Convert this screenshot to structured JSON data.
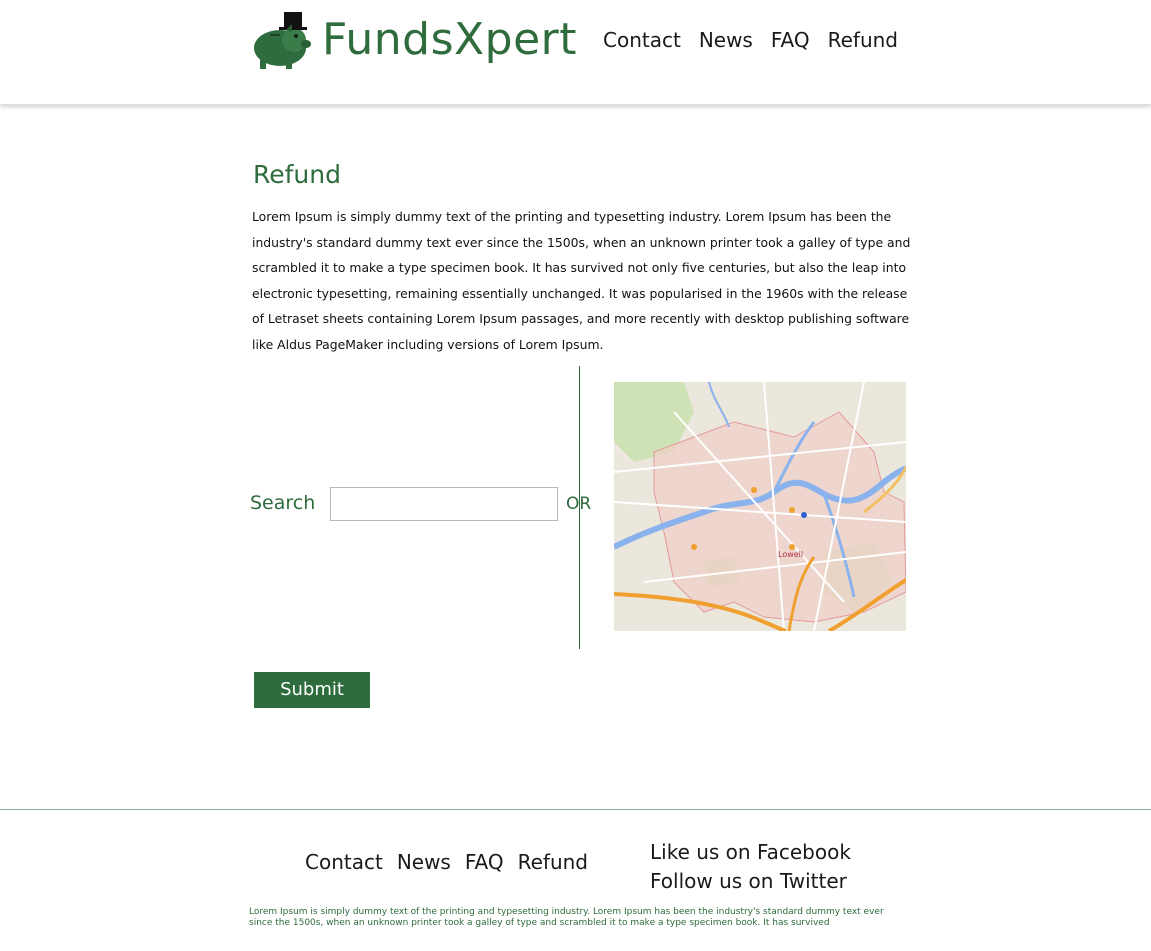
{
  "header": {
    "brand": "FundsXpert",
    "nav": [
      "Contact",
      "News",
      "FAQ",
      "Refund"
    ]
  },
  "main": {
    "title": "Refund",
    "body": "Lorem Ipsum is simply dummy text of the printing and typesetting industry. Lorem Ipsum has been the industry's standard dummy text ever since the 1500s, when an unknown printer took a galley of type and scrambled it to make a type specimen book. It has survived not only five centuries, but also the leap into electronic typesetting, remaining essentially unchanged. It was popularised in the 1960s with the release of Letraset sheets containing Lorem Ipsum passages, and more recently with desktop publishing software like Aldus PageMaker including versions of Lorem Ipsum.",
    "search_label": "Search",
    "search_value": "",
    "or_label": "OR",
    "map_city_label": "Lowell",
    "submit_label": "Submit"
  },
  "footer": {
    "nav": [
      "Contact",
      "News",
      "FAQ",
      "Refund"
    ],
    "facebook": "Like us on Facebook",
    "twitter": "Follow us on Twitter",
    "text": "Lorem Ipsum is simply dummy text of the printing and typesetting industry. Lorem Ipsum has been the industry's standard dummy text ever since the 1500s, when an unknown printer took a galley of type and scrambled it to make a type specimen book. It has survived"
  },
  "colors": {
    "brand_green": "#2e6b3d",
    "map_land": "#e9e4da",
    "map_boundary": "#e8a3a3",
    "map_river": "#7aa6e8",
    "map_highway": "#f0a030"
  },
  "icons": {
    "logo": "piggy-bank-top-hat-icon"
  }
}
